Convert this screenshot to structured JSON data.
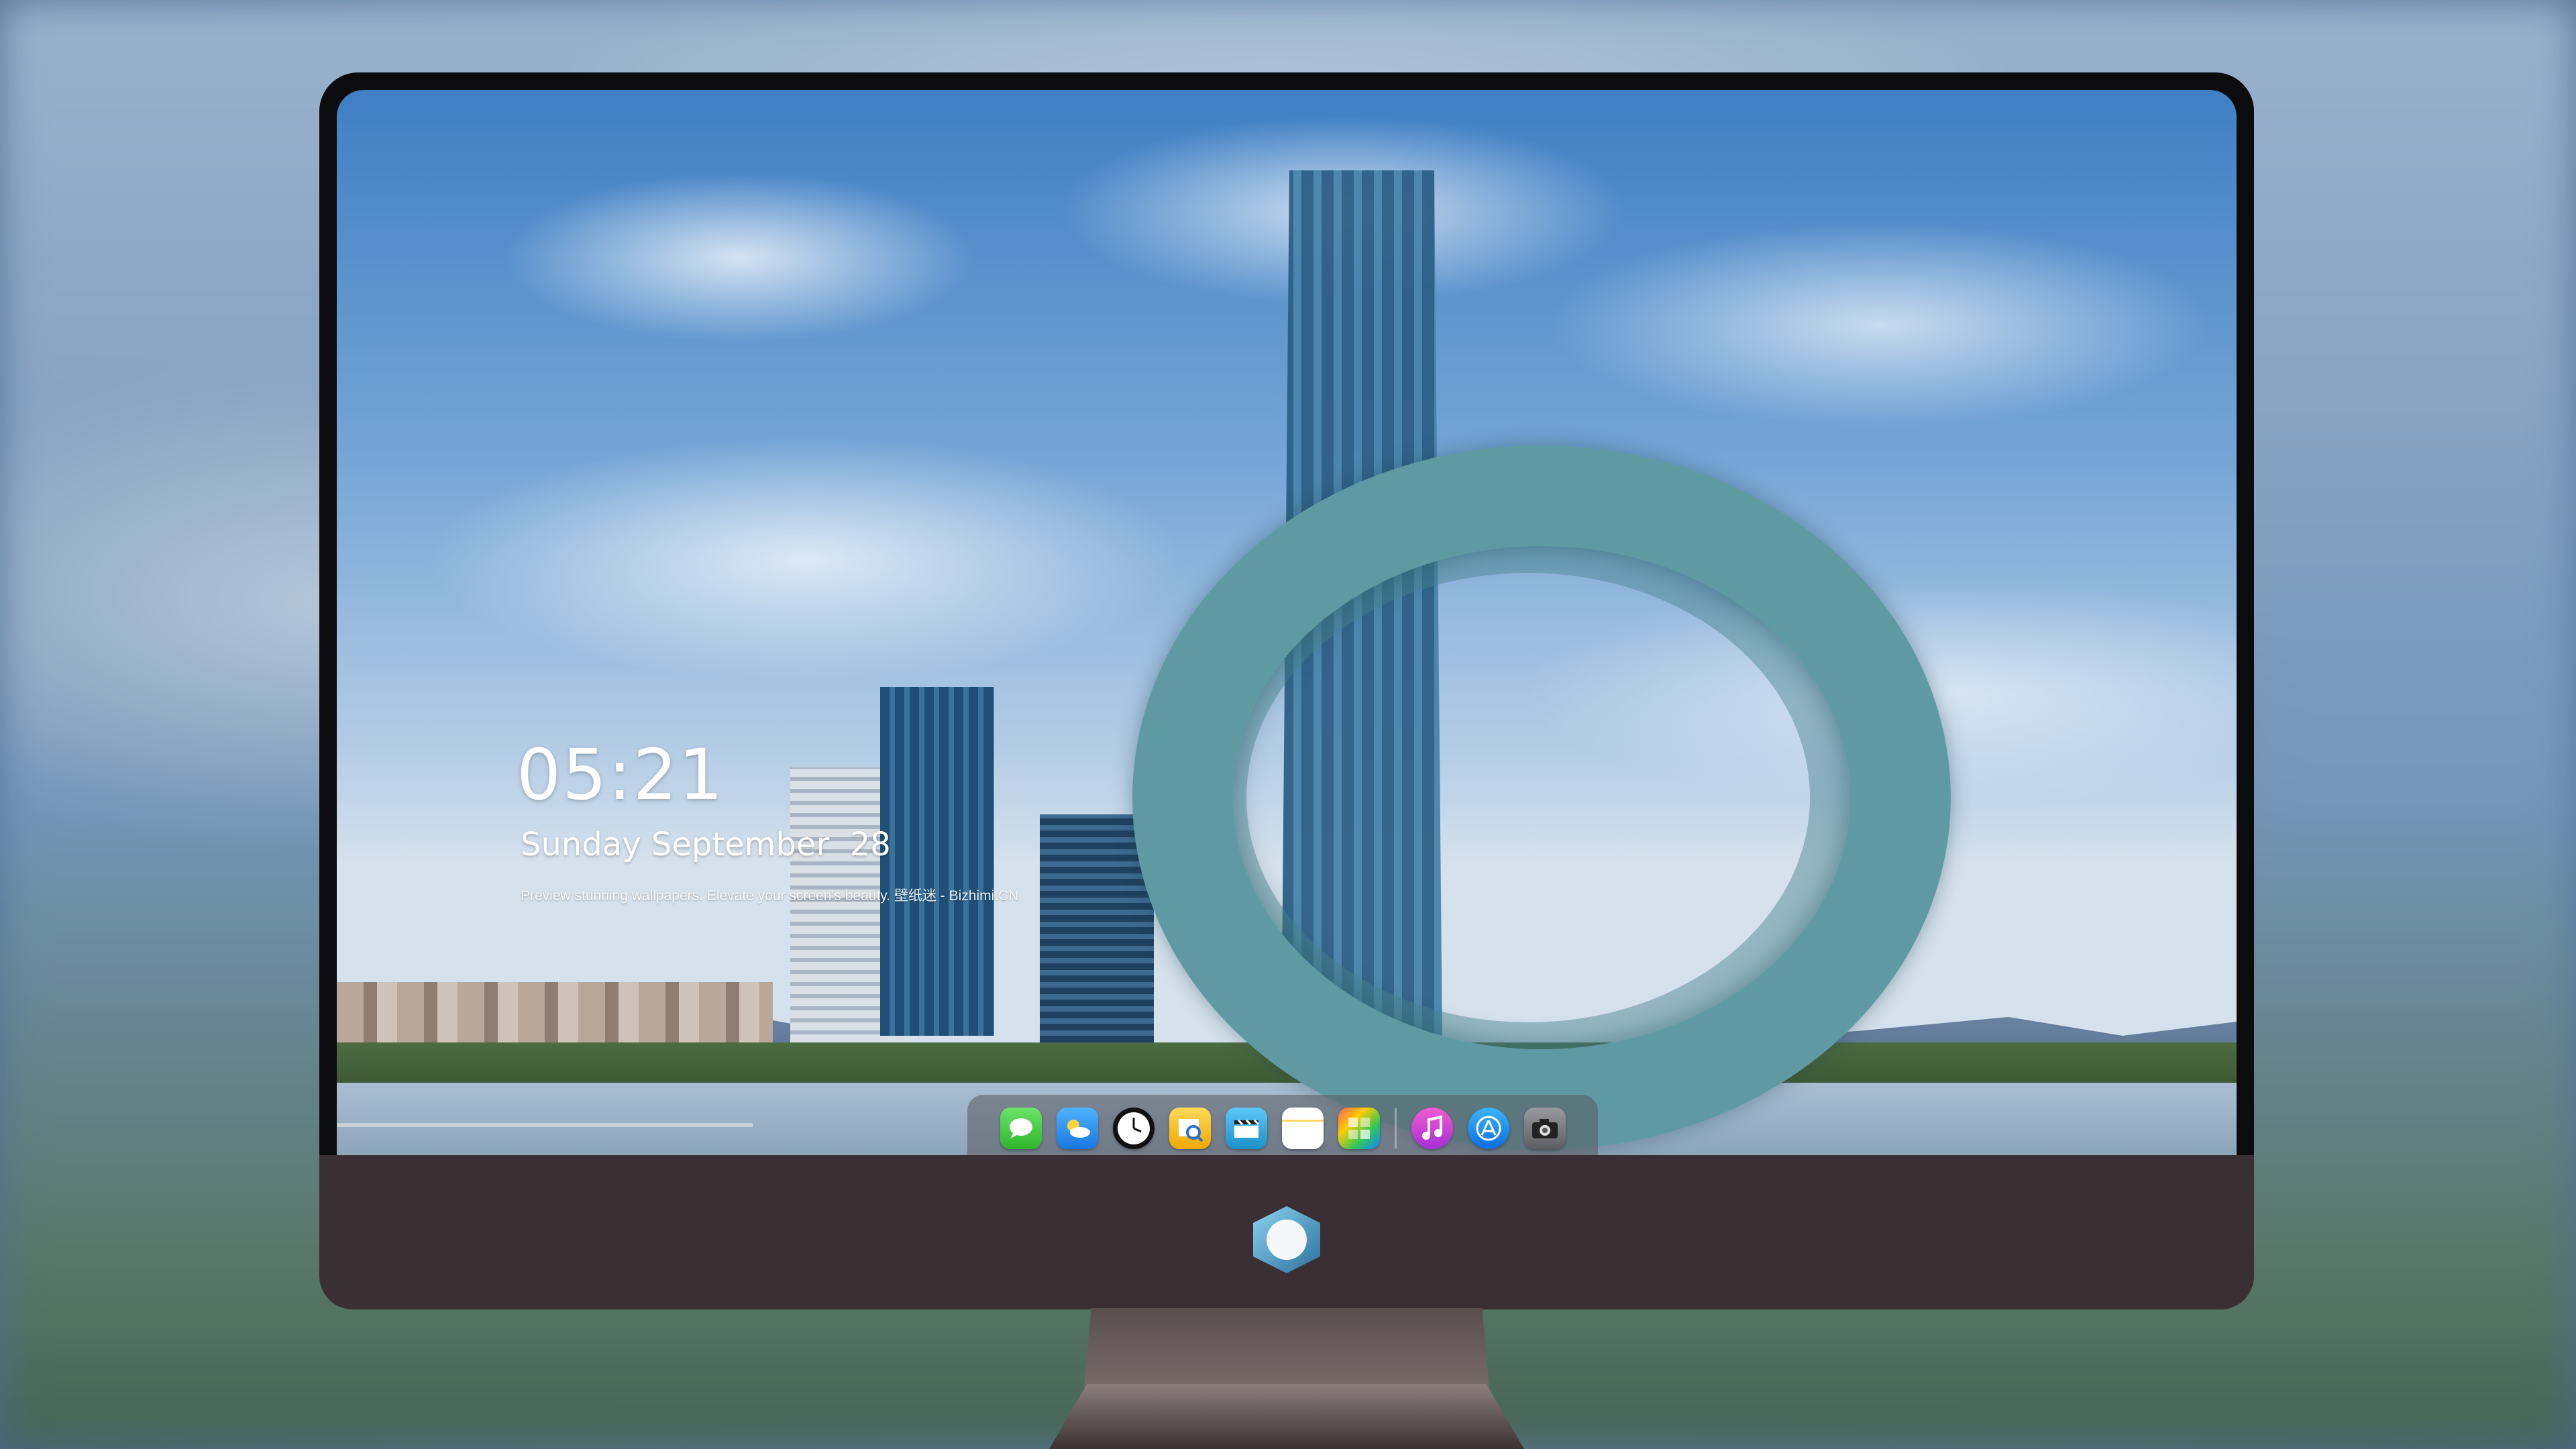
{
  "lock_screen": {
    "time": "05:21",
    "date": "Sunday September  28",
    "tagline": "Preview stunning wallpapers. Elevate your screen's beauty. 壁纸迷 - Bizhimi.CN"
  },
  "dock": {
    "apps": [
      {
        "name": "messages",
        "icon": "messages-icon"
      },
      {
        "name": "weather",
        "icon": "weather-icon"
      },
      {
        "name": "clock",
        "icon": "clock-icon"
      },
      {
        "name": "preview",
        "icon": "preview-icon"
      },
      {
        "name": "clips",
        "icon": "clips-icon"
      },
      {
        "name": "notes",
        "icon": "notes-icon"
      },
      {
        "name": "photos",
        "icon": "photos-icon"
      },
      {
        "name": "music",
        "icon": "music-icon"
      },
      {
        "name": "app-store",
        "icon": "app-store-icon"
      },
      {
        "name": "camera",
        "icon": "camera-icon"
      }
    ]
  },
  "colors": {
    "bezel": "#0c0c0e",
    "chin": "#3a2f33",
    "sky_top": "#3f7fc4",
    "ring": "#5f9aa3"
  }
}
